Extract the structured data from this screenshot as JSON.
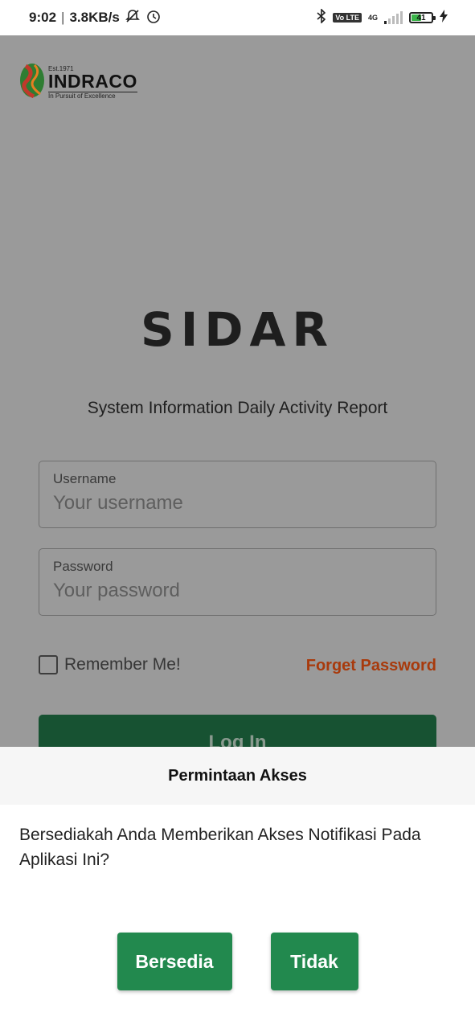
{
  "status_bar": {
    "time": "9:02",
    "network_speed": "3.8KB/s",
    "network_type": "4G",
    "volte": "Vo LTE",
    "battery_level": "41",
    "icons": [
      "mute-bell-icon",
      "alarm-icon",
      "bluetooth-icon",
      "volte-icon",
      "signal-icon",
      "battery-icon",
      "charging-icon"
    ]
  },
  "logo": {
    "est": "Est.1971",
    "name": "INDRACO",
    "tagline": "In Pursuit of Excellence",
    "colors": [
      "#2e7d32",
      "#c0392b",
      "#e67e22"
    ]
  },
  "app": {
    "title": "SIDAR",
    "subtitle": "System Information Daily Activity Report"
  },
  "form": {
    "username_label": "Username",
    "username_placeholder": "Your username",
    "username_value": "",
    "password_label": "Password",
    "password_placeholder": "Your password",
    "password_value": "",
    "remember_label": "Remember Me!",
    "remember_checked": false,
    "forget_label": "Forget Password",
    "login_label": "Log In"
  },
  "dialog": {
    "title": "Permintaan Akses",
    "message": "Bersediakah Anda Memberikan Akses Notifikasi Pada Aplikasi Ini?",
    "accept_label": "Bersedia",
    "decline_label": "Tidak"
  },
  "colors": {
    "primary_green": "#22894e",
    "login_green": "#175232",
    "accent_orange": "#a83a0c",
    "overlay": "#9a9a9a"
  }
}
